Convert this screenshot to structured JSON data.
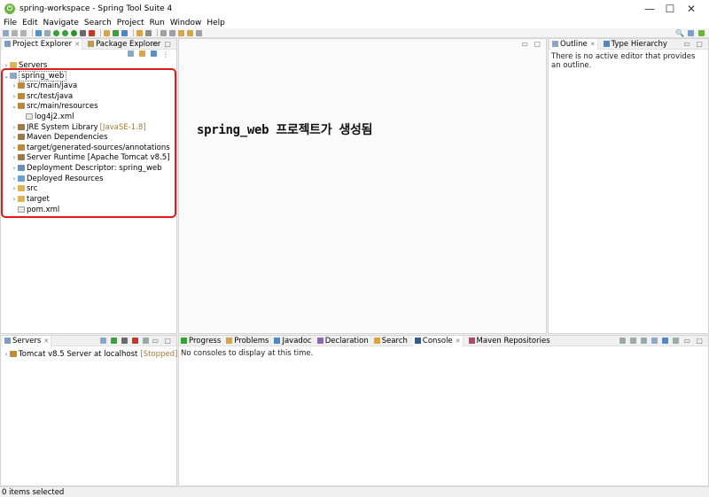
{
  "window": {
    "title": "spring-workspace - Spring Tool Suite 4",
    "controls": [
      "—",
      "☐",
      "✕"
    ]
  },
  "menu": [
    "File",
    "Edit",
    "Navigate",
    "Search",
    "Project",
    "Run",
    "Window",
    "Help"
  ],
  "left_panel": {
    "tabs": [
      {
        "label": "Project Explorer",
        "active": true
      },
      {
        "label": "Package Explorer",
        "active": false
      }
    ],
    "tree": [
      {
        "label": "Servers",
        "indent": 0,
        "expanded": false,
        "icon": "folder-icon"
      },
      {
        "label": "spring_web",
        "indent": 0,
        "expanded": true,
        "icon": "project-icon",
        "selected": true
      },
      {
        "label": "src/main/java",
        "indent": 1,
        "expanded": false,
        "icon": "package-folder-icon"
      },
      {
        "label": "src/test/java",
        "indent": 1,
        "expanded": false,
        "icon": "package-folder-icon"
      },
      {
        "label": "src/main/resources",
        "indent": 1,
        "expanded": true,
        "icon": "package-folder-icon"
      },
      {
        "label": "log4j2.xml",
        "indent": 2,
        "expanded": null,
        "icon": "xml-file-icon"
      },
      {
        "label": "JRE System Library",
        "decoration": "[JavaSE-1.8]",
        "indent": 1,
        "expanded": false,
        "icon": "library-icon"
      },
      {
        "label": "Maven Dependencies",
        "indent": 1,
        "expanded": false,
        "icon": "library-icon"
      },
      {
        "label": "target/generated-sources/annotations",
        "indent": 1,
        "expanded": false,
        "icon": "package-folder-icon"
      },
      {
        "label": "Server Runtime [Apache Tomcat v8.5]",
        "indent": 1,
        "expanded": false,
        "icon": "library-icon"
      },
      {
        "label": "Deployment Descriptor: spring_web",
        "indent": 1,
        "expanded": false,
        "icon": "descriptor-icon"
      },
      {
        "label": "Deployed Resources",
        "indent": 1,
        "expanded": false,
        "icon": "web-resources-icon"
      },
      {
        "label": "src",
        "indent": 1,
        "expanded": false,
        "icon": "folder-icon"
      },
      {
        "label": "target",
        "indent": 1,
        "expanded": false,
        "icon": "folder-icon"
      },
      {
        "label": "pom.xml",
        "indent": 1,
        "expanded": null,
        "icon": "xml-file-icon"
      }
    ]
  },
  "annotation": "spring_web 프로젝트가 생성됨",
  "outline_panel": {
    "tabs": [
      {
        "label": "Outline",
        "active": true
      },
      {
        "label": "Type Hierarchy",
        "active": false
      }
    ],
    "message": "There is no active editor that provides an outline."
  },
  "servers_panel": {
    "tab": "Servers",
    "server_name": "Tomcat v8.5 Server at localhost",
    "server_status": "[Stopped]"
  },
  "bottom_panel": {
    "tabs": [
      {
        "label": "Progress",
        "active": false
      },
      {
        "label": "Problems",
        "active": false
      },
      {
        "label": "Javadoc",
        "active": false
      },
      {
        "label": "Declaration",
        "active": false
      },
      {
        "label": "Search",
        "active": false
      },
      {
        "label": "Console",
        "active": true
      },
      {
        "label": "Maven Repositories",
        "active": false
      }
    ],
    "message": "No consoles to display at this time."
  },
  "status_bar": "0 items selected",
  "colors": {
    "highlight_box": "#e21a1a",
    "decoration": "#a07a3a",
    "spring_green": "#6db33f"
  }
}
